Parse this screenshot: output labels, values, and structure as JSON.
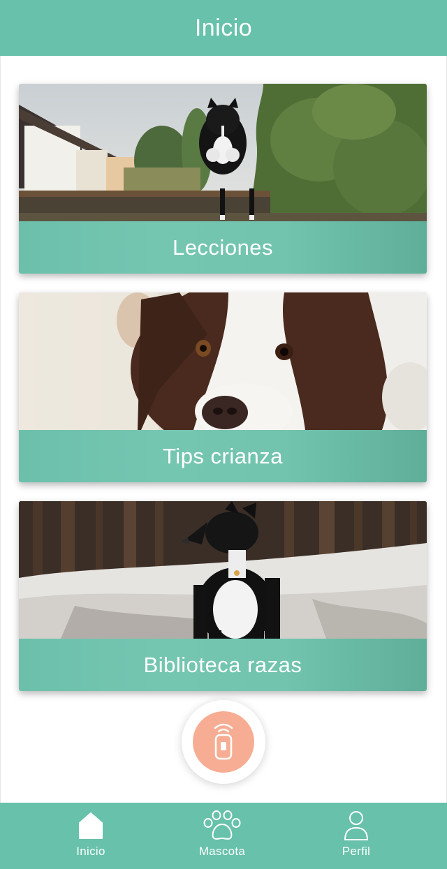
{
  "header": {
    "title": "Inicio"
  },
  "cards": [
    {
      "label": "Lecciones",
      "image": "border-collie-jumping-fence-photo"
    },
    {
      "label": "Tips crianza",
      "image": "border-collie-close-up-photo"
    },
    {
      "label": "Biblioteca razas",
      "image": "border-collie-snow-forest-photo"
    }
  ],
  "fab": {
    "icon": "remote-clicker-icon"
  },
  "bottom_nav": {
    "items": [
      {
        "label": "Inicio",
        "icon": "home-icon"
      },
      {
        "label": "Mascota",
        "icon": "paw-icon"
      },
      {
        "label": "Perfil",
        "icon": "user-icon"
      }
    ]
  },
  "colors": {
    "primary": "#67c1ab",
    "accent": "#f6ad93",
    "background": "#ffffff",
    "text_on_primary": "#ffffff"
  }
}
